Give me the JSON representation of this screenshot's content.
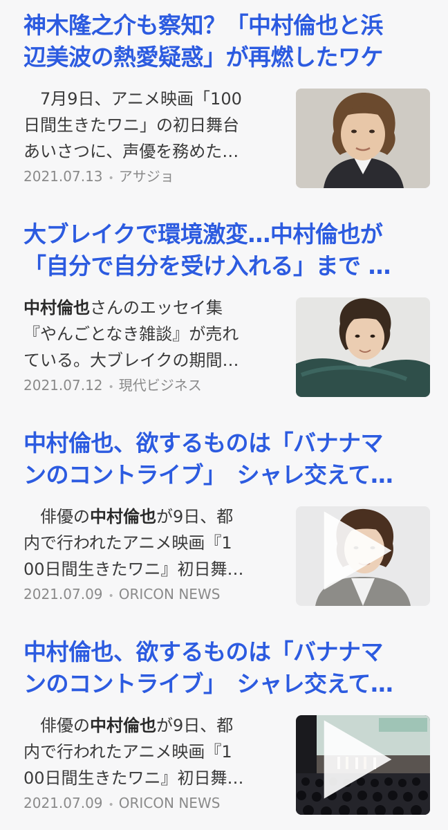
{
  "articles": [
    {
      "title_lines": [
        "神木隆之介も察知？「中村倫也と浜",
        "辺美波の熱愛疑惑」が再燃したワケ"
      ],
      "snippet_lines": [
        {
          "pre": "　7月9日、アニメ映画「100",
          "bold": "",
          "post": ""
        },
        {
          "pre": "日間生きたワニ」の初日舞台",
          "bold": "",
          "post": ""
        },
        {
          "pre": "あいさつに、声優を務めた…",
          "bold": "",
          "post": ""
        }
      ],
      "date": "2021.07.13",
      "source": "アサジョ",
      "thumbnail_icon": "person-portrait-photo",
      "has_video": false
    },
    {
      "title_lines": [
        "大ブレイクで環境激変…中村倫也が",
        "「自分で自分を受け入れる」まで …"
      ],
      "snippet_lines": [
        {
          "pre": "",
          "bold": "中村倫也",
          "post": "さんのエッセイ集"
        },
        {
          "pre": "『やんごとなき雑談』が売れ",
          "bold": "",
          "post": ""
        },
        {
          "pre": "ている。大ブレイクの期間…",
          "bold": "",
          "post": ""
        }
      ],
      "date": "2021.07.12",
      "source": "現代ビジネス",
      "thumbnail_icon": "person-portrait-photo",
      "has_video": false
    },
    {
      "title_lines": [
        "中村倫也、欲するものは「バナナマ",
        "ンのコントライブ」　シャレ交えて…"
      ],
      "snippet_lines": [
        {
          "pre": "　俳優の",
          "bold": "中村倫也",
          "post": "が9日、都"
        },
        {
          "pre": "内で行われたアニメ映画『1",
          "bold": "",
          "post": ""
        },
        {
          "pre": "00日間生きたワニ』初日舞…",
          "bold": "",
          "post": ""
        }
      ],
      "date": "2021.07.09",
      "source": "ORICON NEWS",
      "thumbnail_icon": "person-portrait-photo",
      "has_video": true
    },
    {
      "title_lines": [
        "中村倫也、欲するものは「バナナマ",
        "ンのコントライブ」　シャレ交えて…"
      ],
      "snippet_lines": [
        {
          "pre": "　俳優の",
          "bold": "中村倫也",
          "post": "が9日、都"
        },
        {
          "pre": "内で行われたアニメ映画『1",
          "bold": "",
          "post": ""
        },
        {
          "pre": "00日間生きたワニ』初日舞…",
          "bold": "",
          "post": ""
        }
      ],
      "date": "2021.07.09",
      "source": "ORICON NEWS",
      "thumbnail_icon": "theater-stage-photo",
      "has_video": true
    }
  ],
  "colors": {
    "title": "#2c5be0",
    "text": "#3a3a3a",
    "meta": "#8a8a8a",
    "background": "#f7f7f8"
  }
}
